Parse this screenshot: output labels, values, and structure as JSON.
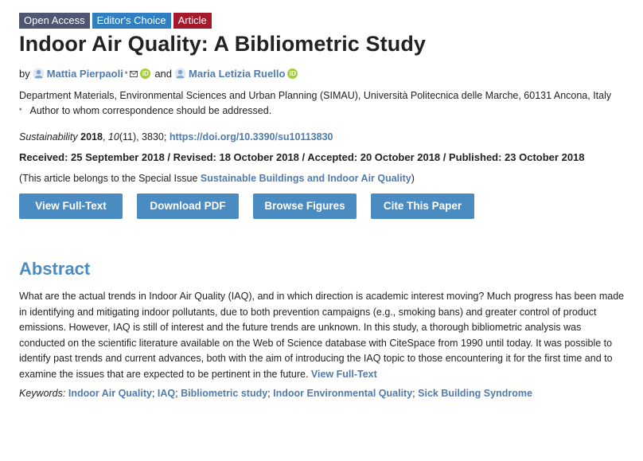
{
  "badges": {
    "open_access": "Open Access",
    "editors_choice": "Editor's Choice",
    "article": "Article"
  },
  "title": "Indoor Air Quality: A Bibliometric Study",
  "authors": {
    "by": "by",
    "author1": "Mattia Pierpaoli",
    "author1_mark": "*",
    "and": "and",
    "author2": "Maria Letizia Ruello"
  },
  "affiliation": "Department Materials, Environmental Sciences and Urban Planning (SIMAU), Università Politecnica delle Marche, 60131 Ancona, Italy",
  "correspondence": {
    "mark": "*",
    "text": "Author to whom correspondence should be addressed."
  },
  "citation": {
    "journal": "Sustainability",
    "year": "2018",
    "volume": "10",
    "issue_pages": "(11), 3830;",
    "doi": "https://doi.org/10.3390/su10113830"
  },
  "dates": "Received: 25 September 2018 / Revised: 18 October 2018 / Accepted: 20 October 2018 / Published: 23 October 2018",
  "special_issue": {
    "prefix": "(This article belongs to the Special Issue ",
    "link": "Sustainable Buildings and Indoor Air Quality",
    "suffix": ")"
  },
  "buttons": {
    "view_full_text": "View Full-Text",
    "download_pdf": "Download PDF",
    "browse_figures": "Browse Figures",
    "cite_paper": "Cite This Paper"
  },
  "abstract": {
    "heading": "Abstract",
    "text": "What are the actual trends in Indoor Air Quality (IAQ), and in which direction is academic interest moving? Much progress has been made in identifying and mitigating indoor pollutants, due to both prevention campaigns (e.g., smoking bans) and greater control of product emissions. However, IAQ is still of interest and the future trends are unknown. In this study, a thorough bibliometric analysis was conducted on the scientific literature available on the Web of Science database with CiteSpace from 1990 until today. It was possible to identify past trends and current advances, both with the aim of introducing the IAQ topic to those encountering it for the first time and to examine the issues that are expected to be pertinent in the future.",
    "more_link": "View Full-Text"
  },
  "keywords": {
    "label": "Keywords:",
    "items": [
      "Indoor Air Quality",
      "IAQ",
      "Bibliometric study",
      "Indoor Environmental Quality",
      "Sick Building Syndrome"
    ],
    "sep": ";"
  },
  "colors": {
    "link": "#4f7bb0",
    "button": "#4a8bc1",
    "badge_oa": "#4f5671",
    "badge_ec": "#2f7fc1",
    "badge_article": "#a4192b",
    "orcid": "#a6ce39"
  },
  "icons": [
    "person-icon",
    "mail-icon",
    "orcid-icon"
  ]
}
